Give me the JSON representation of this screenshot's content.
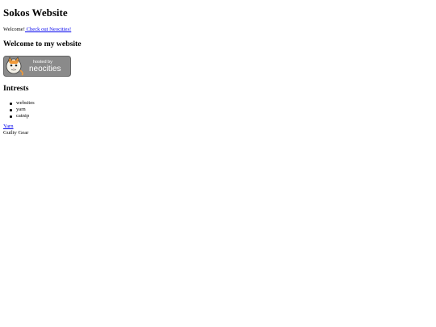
{
  "page": {
    "title": "Sokos Website",
    "welcome_text": "Welcome!",
    "neocities_link": " Check out Neocities!",
    "subheading": "Welcome to my website",
    "badge": {
      "small_text": "hosted by",
      "brand_text": "neocities",
      "icon": "neocities-cat-icon"
    },
    "interests_heading": "Intrests",
    "interests": [
      "websites",
      "yarn",
      "catnip"
    ],
    "yarn_link": "Yarn",
    "guilty_gear": "Guilty Gear"
  },
  "colors": {
    "link": "#0000ee",
    "badge_background": "#8a8a8a",
    "badge_text": "#ffffff"
  }
}
